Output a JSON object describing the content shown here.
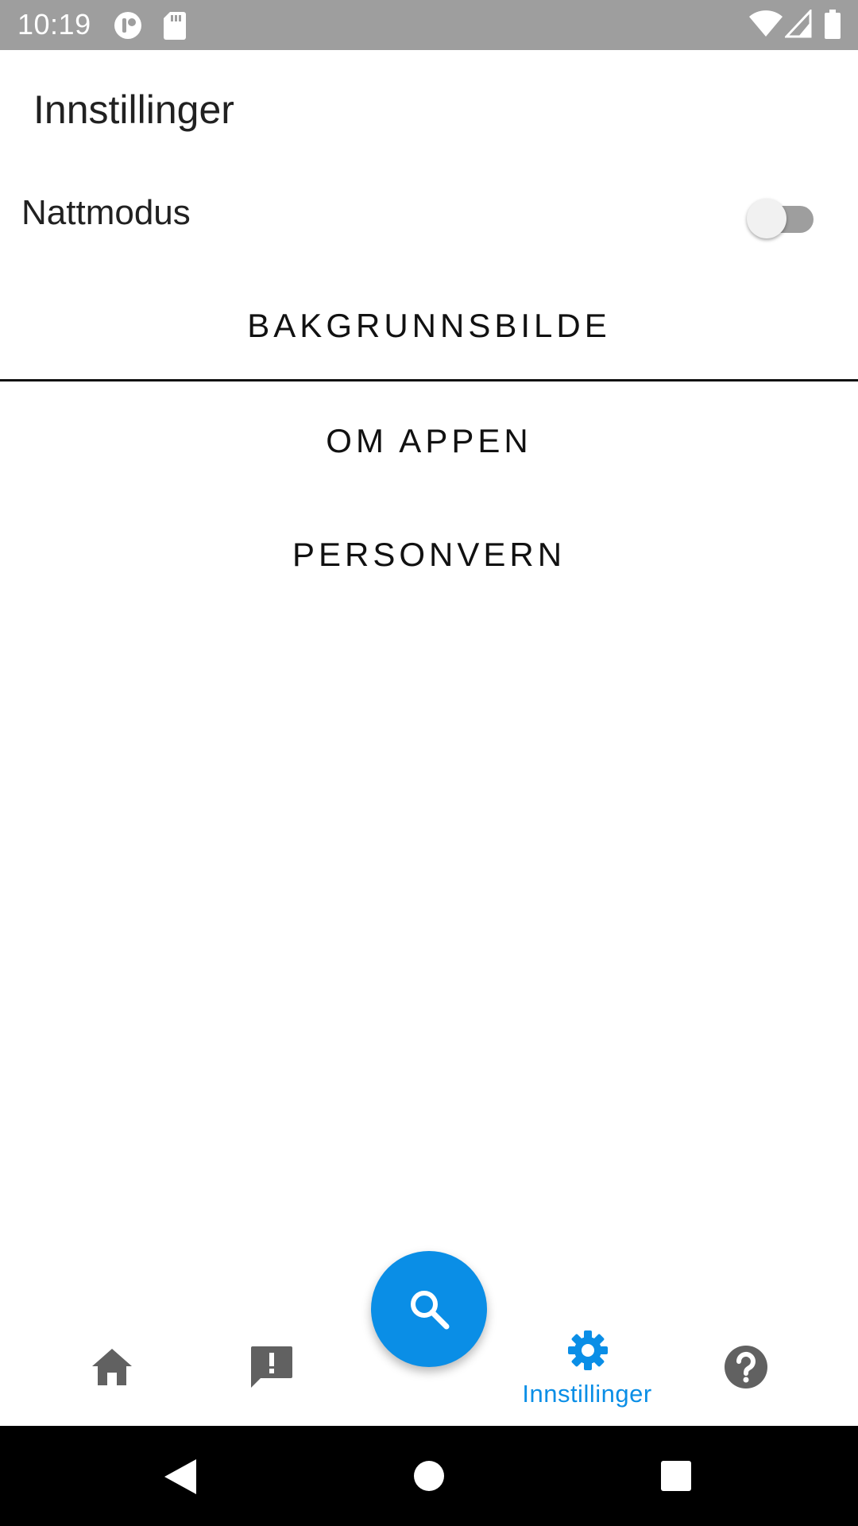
{
  "status_bar": {
    "time": "10:19",
    "icons": [
      "notification-app-icon",
      "sd-card-icon",
      "wifi-icon",
      "cell-signal-icon",
      "battery-icon"
    ]
  },
  "page": {
    "title": "Innstillinger"
  },
  "settings": {
    "night_mode_label": "Nattmodus",
    "night_mode_on": false
  },
  "menu": {
    "background_label": "BAKGRUNNSBILDE",
    "about_label": "OM APPEN",
    "privacy_label": "PERSONVERN"
  },
  "bottom_nav": {
    "items": [
      {
        "icon": "home-icon",
        "label": ""
      },
      {
        "icon": "report-icon",
        "label": ""
      },
      {
        "icon": "settings-icon",
        "label": "Innstillinger",
        "active": true
      },
      {
        "icon": "help-icon",
        "label": ""
      }
    ],
    "fab_icon": "search-icon"
  },
  "system_nav": {
    "icons": [
      "back-icon",
      "home-circle-icon",
      "recents-icon"
    ]
  },
  "colors": {
    "accent": "#0a8ee6",
    "status_bar": "#9e9e9e",
    "inactive_icon": "#616161",
    "system_nav": "#000000"
  }
}
